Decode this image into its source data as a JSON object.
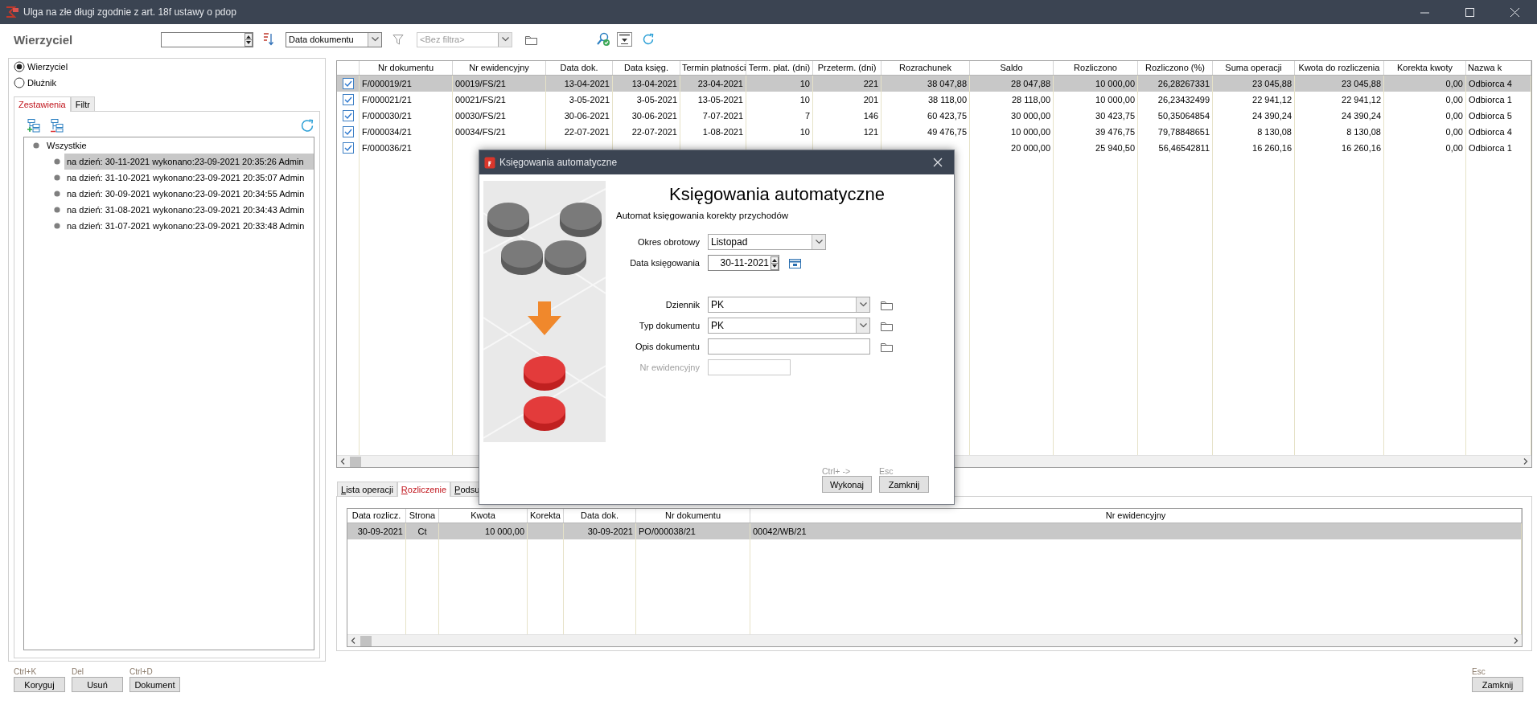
{
  "window": {
    "title": "Ulga na złe długi zgodnie z art. 18f ustawy o pdop"
  },
  "heading": "Wierzyciel",
  "toolbar": {
    "sort_field": "Data dokumentu",
    "filter": {
      "placeholder": "<Bez filtra>",
      "disabled": true
    }
  },
  "party": [
    {
      "label": "Wierzyciel",
      "selected": true
    },
    {
      "label": "Dłużnik",
      "selected": false
    }
  ],
  "left_tabs": [
    {
      "label": "Zestawienia",
      "selected": true
    },
    {
      "label": "Filtr",
      "selected": false
    }
  ],
  "tree": {
    "label": "Wszystkie",
    "children": [
      {
        "label": "na dzień: 30-11-2021 wykonano:23-09-2021 20:35:26 Admin",
        "selected": true
      },
      {
        "label": "na dzień: 31-10-2021 wykonano:23-09-2021 20:35:07 Admin",
        "selected": false
      },
      {
        "label": "na dzień: 30-09-2021 wykonano:23-09-2021 20:34:55 Admin",
        "selected": false
      },
      {
        "label": "na dzień: 31-08-2021 wykonano:23-09-2021 20:34:43 Admin",
        "selected": false
      },
      {
        "label": "na dzień: 31-07-2021 wykonano:23-09-2021 20:33:48 Admin",
        "selected": false
      }
    ]
  },
  "table": {
    "columns": [
      "Nr dokumentu",
      "Nr ewidencyjny",
      "Data dok.",
      "Data księg.",
      "Termin płatności",
      "Term. płat. (dni)",
      "Przeterm. (dni)",
      "Rozrachunek",
      "Saldo",
      "Rozliczono",
      "Rozliczono (%)",
      "Suma operacji",
      "Kwota do rozliczenia",
      "Korekta kwoty",
      "Nazwa k"
    ],
    "rows": [
      {
        "checked": true,
        "selected": true,
        "cells": [
          "F/000019/21",
          "00019/FS/21",
          "13-04-2021",
          "13-04-2021",
          "23-04-2021",
          "10",
          "221",
          "38 047,88",
          "28 047,88",
          "10 000,00",
          "26,28267331",
          "23 045,88",
          "23 045,88",
          "0,00",
          "Odbiorca 4"
        ]
      },
      {
        "checked": true,
        "selected": false,
        "cells": [
          "F/000021/21",
          "00021/FS/21",
          "3-05-2021",
          "3-05-2021",
          "13-05-2021",
          "10",
          "201",
          "38 118,00",
          "28 118,00",
          "10 000,00",
          "26,23432499",
          "22 941,12",
          "22 941,12",
          "0,00",
          "Odbiorca 1"
        ]
      },
      {
        "checked": true,
        "selected": false,
        "cells": [
          "F/000030/21",
          "00030/FS/21",
          "30-06-2021",
          "30-06-2021",
          "7-07-2021",
          "7",
          "146",
          "60 423,75",
          "30 000,00",
          "30 423,75",
          "50,35064854",
          "24 390,24",
          "24 390,24",
          "0,00",
          "Odbiorca 5"
        ]
      },
      {
        "checked": true,
        "selected": false,
        "cells": [
          "F/000034/21",
          "00034/FS/21",
          "22-07-2021",
          "22-07-2021",
          "1-08-2021",
          "10",
          "121",
          "49 476,75",
          "10 000,00",
          "39 476,75",
          "79,78848651",
          "8 130,08",
          "8 130,08",
          "0,00",
          "Odbiorca 4"
        ]
      },
      {
        "checked": true,
        "selected": false,
        "cells": [
          "F/000036/21",
          null,
          null,
          null,
          null,
          null,
          null,
          null,
          "20 000,00",
          "25 940,50",
          "56,46542811",
          "16 260,16",
          "16 260,16",
          "0,00",
          "Odbiorca 1"
        ]
      }
    ]
  },
  "bottom_tabs": [
    {
      "label": "Lista operacji",
      "selected": false
    },
    {
      "label": "Rozliczenie",
      "selected": true
    },
    {
      "label": "Podsu",
      "selected": false
    }
  ],
  "settlement_table": {
    "columns": [
      "Data rozlicz.",
      "Strona",
      "Kwota",
      "Korekta",
      "Data dok.",
      "Nr dokumentu",
      "Nr ewidencyjny"
    ],
    "rows": [
      {
        "selected": true,
        "cells": [
          "30-09-2021",
          "Ct",
          "10 000,00",
          null,
          "30-09-2021",
          "PO/000038/21",
          "00042/WB/21"
        ]
      }
    ]
  },
  "actions": [
    {
      "shortcut": "Ctrl+K",
      "label": "Koryguj"
    },
    {
      "shortcut": "Del",
      "label": "Usuń"
    },
    {
      "shortcut": "Ctrl+D",
      "label": "Dokument"
    }
  ],
  "close_action": {
    "shortcut": "Esc",
    "label": "Zamknij"
  },
  "dialog": {
    "title": "Księgowania automatyczne",
    "heading": "Księgowania automatyczne",
    "subtitle": "Automat księgowania korekty przychodów",
    "period_fields": [
      {
        "kind": "select",
        "label": "Okres obrotowy",
        "value": "Listopad"
      },
      {
        "kind": "date",
        "label": "Data księgowania",
        "value": "30-11-2021"
      }
    ],
    "document_fields": [
      {
        "kind": "select",
        "label": "Dziennik",
        "value": "PK",
        "browse": true
      },
      {
        "kind": "select",
        "label": "Typ dokumentu",
        "value": "PK",
        "browse": true
      },
      {
        "kind": "text",
        "label": "Opis dokumentu",
        "browse": true,
        "disabled": false
      },
      {
        "kind": "text",
        "label": "Nr ewidencyjny",
        "disabled": true
      }
    ],
    "buttons": [
      {
        "shortcut": "Ctrl+ ->",
        "label": "Wykonaj"
      },
      {
        "shortcut": "Esc",
        "label": "Zamknij"
      }
    ]
  }
}
